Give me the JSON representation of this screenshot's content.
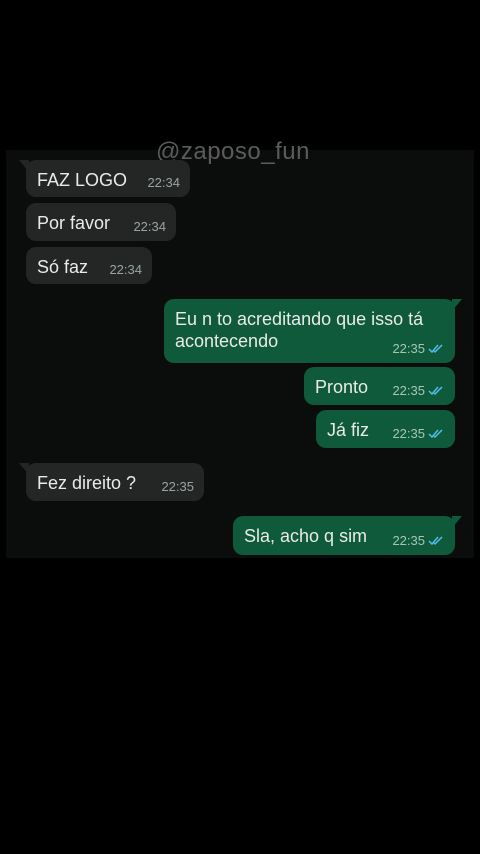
{
  "watermark": "@zaposo_fun",
  "colors": {
    "incoming_bubble": "#242626",
    "outgoing_bubble": "#0e5a3a",
    "read_ticks": "#53bdeb",
    "background": "#000000"
  },
  "messages": [
    {
      "direction": "in",
      "text": "FAZ LOGO",
      "time": "22:34"
    },
    {
      "direction": "in",
      "text": "Por favor",
      "time": "22:34"
    },
    {
      "direction": "in",
      "text": "Só faz",
      "time": "22:34"
    },
    {
      "direction": "out",
      "text": "Eu n to acreditando que isso tá acontecendo",
      "time": "22:35",
      "status": "read-ticks-icon"
    },
    {
      "direction": "out",
      "text": "Pronto",
      "time": "22:35",
      "status": "read-ticks-icon"
    },
    {
      "direction": "out",
      "text": "Já fiz",
      "time": "22:35",
      "status": "read-ticks-icon"
    },
    {
      "direction": "in",
      "text": "Fez direito ?",
      "time": "22:35"
    },
    {
      "direction": "out",
      "text": "Sla, acho q sim",
      "time": "22:35",
      "status": "read-ticks-icon"
    }
  ]
}
